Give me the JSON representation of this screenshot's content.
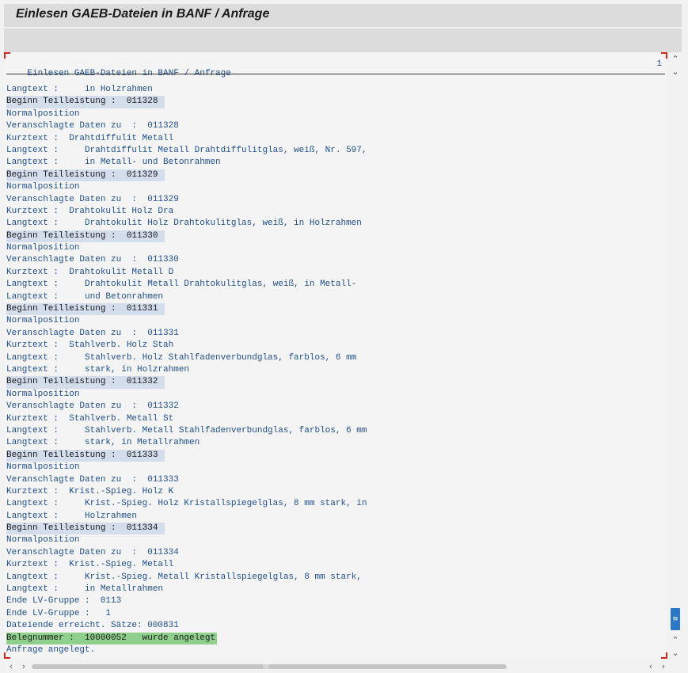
{
  "window": {
    "title": "Einlesen GAEB-Dateien in BANF / Anfrage"
  },
  "list": {
    "header": "Einlesen GAEB-Dateien in BANF / Anfrage",
    "page_number": "1",
    "lines": [
      {
        "text": "Langtext :     in Holzrahmen",
        "style": "normal"
      },
      {
        "text": "Beginn Teilleistung :  011328 ",
        "style": "highlight"
      },
      {
        "text": "Normalposition",
        "style": "normal"
      },
      {
        "text": "Veranschlagte Daten zu  :  011328",
        "style": "normal"
      },
      {
        "text": "Kurztext :  Drahtdiffulit Metall",
        "style": "normal"
      },
      {
        "text": "Langtext :     Drahtdiffulit Metall Drahtdiffulitglas, weiß, Nr. 597,",
        "style": "normal"
      },
      {
        "text": "Langtext :     in Metall- und Betonrahmen",
        "style": "normal"
      },
      {
        "text": "Beginn Teilleistung :  011329 ",
        "style": "highlight"
      },
      {
        "text": "Normalposition",
        "style": "normal"
      },
      {
        "text": "Veranschlagte Daten zu  :  011329",
        "style": "normal"
      },
      {
        "text": "Kurztext :  Drahtokulit Holz Dra",
        "style": "normal"
      },
      {
        "text": "Langtext :     Drahtokulit Holz Drahtokulitglas, weiß, in Holzrahmen",
        "style": "normal"
      },
      {
        "text": "Beginn Teilleistung :  011330 ",
        "style": "highlight"
      },
      {
        "text": "Normalposition",
        "style": "normal"
      },
      {
        "text": "Veranschlagte Daten zu  :  011330",
        "style": "normal"
      },
      {
        "text": "Kurztext :  Drahtokulit Metall D",
        "style": "normal"
      },
      {
        "text": "Langtext :     Drahtokulit Metall Drahtokulitglas, weiß, in Metall-",
        "style": "normal"
      },
      {
        "text": "Langtext :     und Betonrahmen",
        "style": "normal"
      },
      {
        "text": "Beginn Teilleistung :  011331 ",
        "style": "highlight"
      },
      {
        "text": "Normalposition",
        "style": "normal"
      },
      {
        "text": "Veranschlagte Daten zu  :  011331",
        "style": "normal"
      },
      {
        "text": "Kurztext :  Stahlverb. Holz Stah",
        "style": "normal"
      },
      {
        "text": "Langtext :     Stahlverb. Holz Stahlfadenverbundglas, farblos, 6 mm",
        "style": "normal"
      },
      {
        "text": "Langtext :     stark, in Holzrahmen",
        "style": "normal"
      },
      {
        "text": "Beginn Teilleistung :  011332 ",
        "style": "highlight"
      },
      {
        "text": "Normalposition",
        "style": "normal"
      },
      {
        "text": "Veranschlagte Daten zu  :  011332",
        "style": "normal"
      },
      {
        "text": "Kurztext :  Stahlverb. Metall St",
        "style": "normal"
      },
      {
        "text": "Langtext :     Stahlverb. Metall Stahlfadenverbundglas, farblos, 6 mm",
        "style": "normal"
      },
      {
        "text": "Langtext :     stark, in Metallrahmen",
        "style": "normal"
      },
      {
        "text": "Beginn Teilleistung :  011333 ",
        "style": "highlight"
      },
      {
        "text": "Normalposition",
        "style": "normal"
      },
      {
        "text": "Veranschlagte Daten zu  :  011333",
        "style": "normal"
      },
      {
        "text": "Kurztext :  Krist.-Spieg. Holz K",
        "style": "normal"
      },
      {
        "text": "Langtext :     Krist.-Spieg. Holz Kristallspiegelglas, 8 mm stark, in",
        "style": "normal"
      },
      {
        "text": "Langtext :     Holzrahmen",
        "style": "normal"
      },
      {
        "text": "Beginn Teilleistung :  011334 ",
        "style": "highlight"
      },
      {
        "text": "Normalposition",
        "style": "normal"
      },
      {
        "text": "Veranschlagte Daten zu  :  011334",
        "style": "normal"
      },
      {
        "text": "Kurztext :  Krist.-Spieg. Metall",
        "style": "normal"
      },
      {
        "text": "Langtext :     Krist.-Spieg. Metall Kristallspiegelglas, 8 mm stark,",
        "style": "normal"
      },
      {
        "text": "Langtext :     in Metallrahmen",
        "style": "normal"
      },
      {
        "text": "Ende LV-Gruppe :  0113",
        "style": "normal"
      },
      {
        "text": "Ende LV-Gruppe :   1",
        "style": "normal"
      },
      {
        "text": "Dateiende erreicht. Sätze: 000831",
        "style": "normal"
      },
      {
        "text": "Belegnummer :  10000052   wurde angelegt",
        "style": "success"
      },
      {
        "text": "Anfrage angelegt.",
        "style": "normal"
      }
    ]
  },
  "colors": {
    "highlight_bg": "#d3ddec",
    "success_bg": "#8fd18c",
    "text": "#21508c",
    "focus_corner": "#d9241c",
    "scroll_grip": "#2a78c5"
  },
  "icons": {
    "scroll_up": "chevron-up-icon",
    "scroll_down": "chevron-down-icon",
    "scroll_left": "chevron-left-icon",
    "scroll_right": "chevron-right-icon",
    "grip": "grip-icon"
  }
}
